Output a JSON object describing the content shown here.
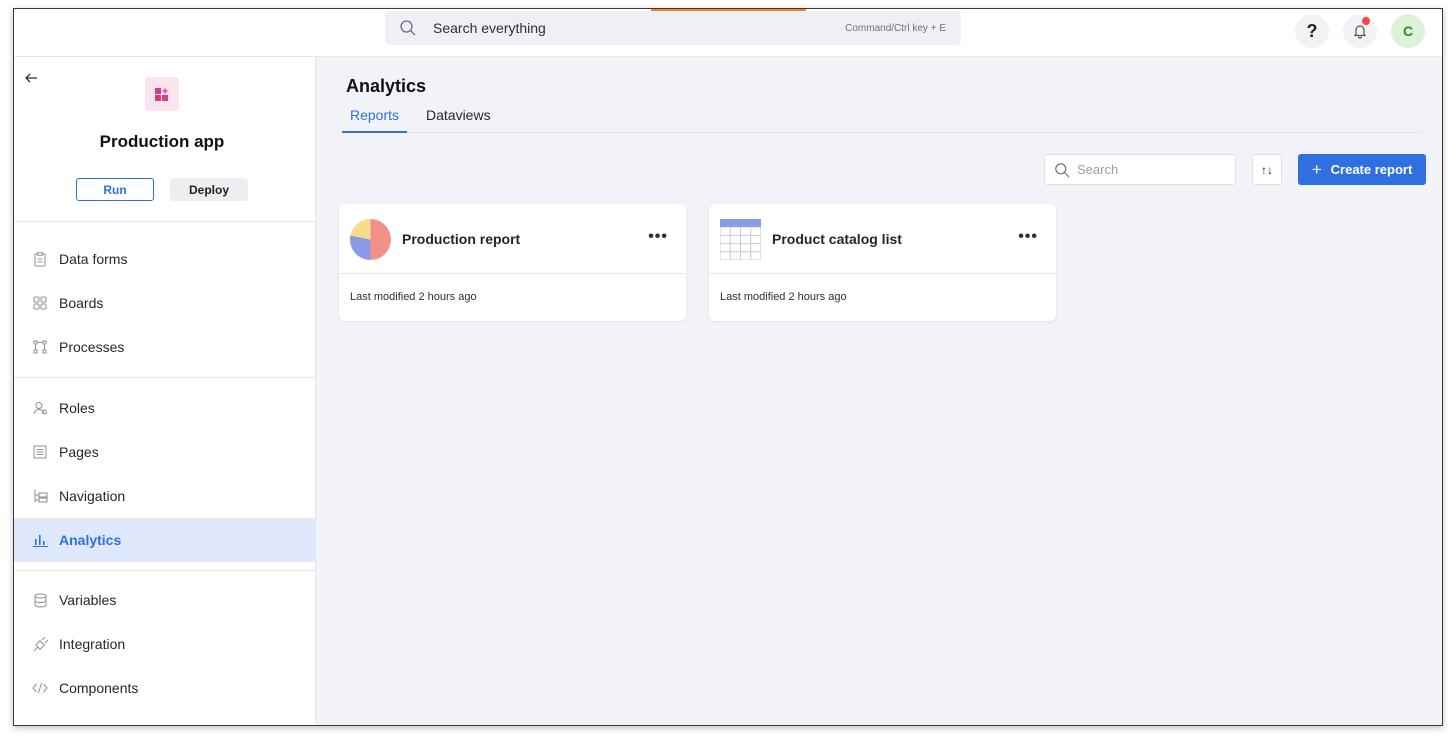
{
  "topbar": {
    "search_placeholder": "Search everything",
    "search_hint": "Command/Ctrl key + E",
    "help_label": "?",
    "avatar_initial": "C",
    "accent": "#2f6fe0"
  },
  "sidebar": {
    "app_name": "Production app",
    "run_label": "Run",
    "deploy_label": "Deploy",
    "items": [
      {
        "label": "Data forms",
        "icon": "clipboard-icon"
      },
      {
        "label": "Boards",
        "icon": "grid-icon"
      },
      {
        "label": "Processes",
        "icon": "workflow-icon"
      },
      {
        "label": "Roles",
        "icon": "users-icon"
      },
      {
        "label": "Pages",
        "icon": "page-icon"
      },
      {
        "label": "Navigation",
        "icon": "tree-icon"
      },
      {
        "label": "Analytics",
        "icon": "bar-chart-icon",
        "active": true
      },
      {
        "label": "Variables",
        "icon": "database-icon"
      },
      {
        "label": "Integration",
        "icon": "plug-icon"
      },
      {
        "label": "Components",
        "icon": "code-icon"
      }
    ]
  },
  "main": {
    "title": "Analytics",
    "tabs": [
      {
        "label": "Reports",
        "active": true
      },
      {
        "label": "Dataviews",
        "active": false
      }
    ],
    "search_placeholder": "Search",
    "sort_label": "↑↓",
    "create_label": "Create report",
    "cards": [
      {
        "title": "Production report",
        "icon": "pie-chart-icon",
        "modified": "Last modified 2 hours ago"
      },
      {
        "title": "Product catalog list",
        "icon": "table-icon",
        "modified": "Last modified 2 hours ago"
      }
    ]
  }
}
